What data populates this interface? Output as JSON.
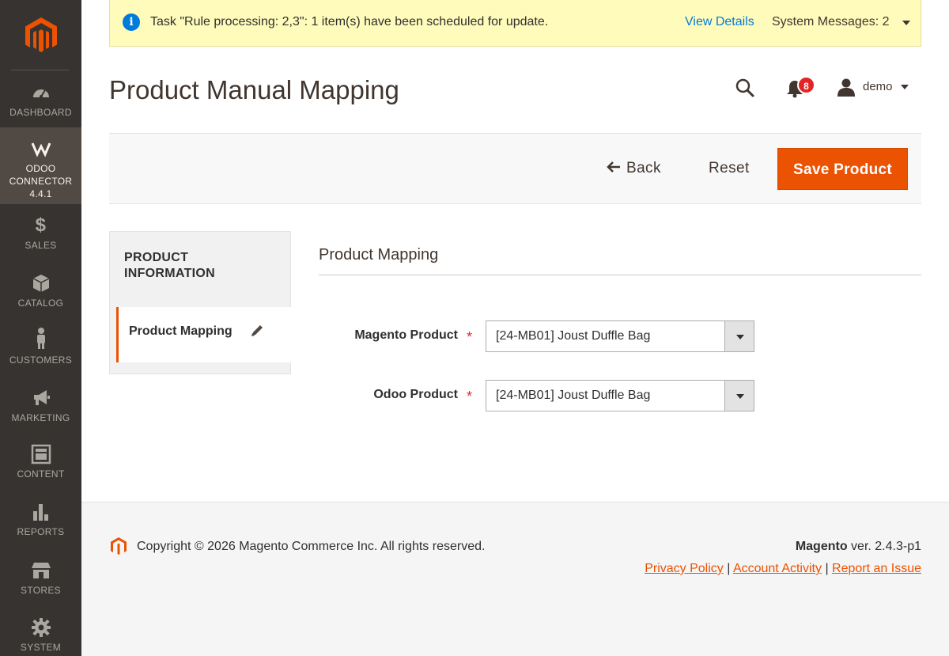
{
  "sidebar": {
    "items": [
      {
        "key": "dashboard",
        "label": "DASHBOARD"
      },
      {
        "key": "odoo",
        "label": "ODOO CONNECTOR 4.4.1"
      },
      {
        "key": "sales",
        "label": "SALES"
      },
      {
        "key": "catalog",
        "label": "CATALOG"
      },
      {
        "key": "customers",
        "label": "CUSTOMERS"
      },
      {
        "key": "marketing",
        "label": "MARKETING"
      },
      {
        "key": "content",
        "label": "CONTENT"
      },
      {
        "key": "reports",
        "label": "REPORTS"
      },
      {
        "key": "stores",
        "label": "STORES"
      },
      {
        "key": "system",
        "label": "SYSTEM"
      }
    ],
    "odoo_line1": "ODOO",
    "odoo_line2": "CONNECTOR",
    "odoo_line3": "4.4.1",
    "active": "odoo"
  },
  "notice": {
    "message": "Task \"Rule processing: 2,3\": 1 item(s) have been scheduled for update.",
    "view_details": "View Details",
    "system_messages": "System Messages: 2"
  },
  "header": {
    "title": "Product Manual Mapping",
    "notifications_count": "8",
    "user": "demo"
  },
  "actions": {
    "back": "Back",
    "reset": "Reset",
    "save": "Save Product"
  },
  "tabs": {
    "title_line1": "PRODUCT",
    "title_line2": "INFORMATION",
    "item": "Product Mapping"
  },
  "form": {
    "section_title": "Product Mapping",
    "magento_label": "Magento Product",
    "magento_value": "[24-MB01] Joust Duffle Bag",
    "odoo_label": "Odoo Product",
    "odoo_value": "[24-MB01] Joust Duffle Bag",
    "required_mark": "*"
  },
  "footer": {
    "copyright": "Copyright © 2026 Magento Commerce Inc. All rights reserved.",
    "brand": "Magento",
    "version": "ver. 2.4.3-p1",
    "privacy": "Privacy Policy",
    "activity": "Account Activity",
    "report": "Report an Issue",
    "separator": "|"
  },
  "colors": {
    "accent": "#eb5202",
    "sidebar": "#373330",
    "notice_bg": "#fffbbb",
    "link": "#007bdb"
  }
}
